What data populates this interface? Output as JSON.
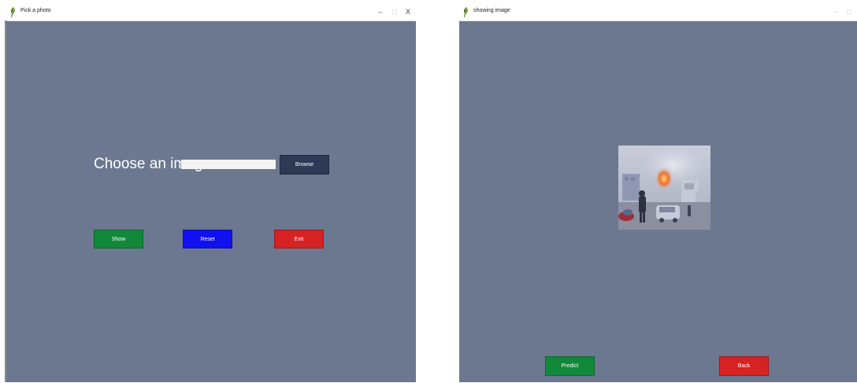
{
  "colors": {
    "window_bg": "#6b7890",
    "browse_bg": "#2d3a55",
    "show_bg": "#12883a",
    "reset_bg": "#1010f0",
    "exit_bg": "#d62222",
    "predict_bg": "#12883a",
    "back_bg": "#d62222"
  },
  "pick_window": {
    "title": "Pick a photo",
    "minimize_glyph": "–",
    "maximize_glyph": "□",
    "close_glyph": "X",
    "prompt": "Choose an image :",
    "path_value": "",
    "browse_label": "Browse",
    "show_label": "Show",
    "reset_label": "Reset",
    "exit_label": "Exit"
  },
  "show_window": {
    "title": "showing image",
    "minimize_glyph": "–",
    "maximize_glyph": "□",
    "photo_icon": "street-fire-photo",
    "predict_label": "Predict",
    "back_label": "Back"
  }
}
